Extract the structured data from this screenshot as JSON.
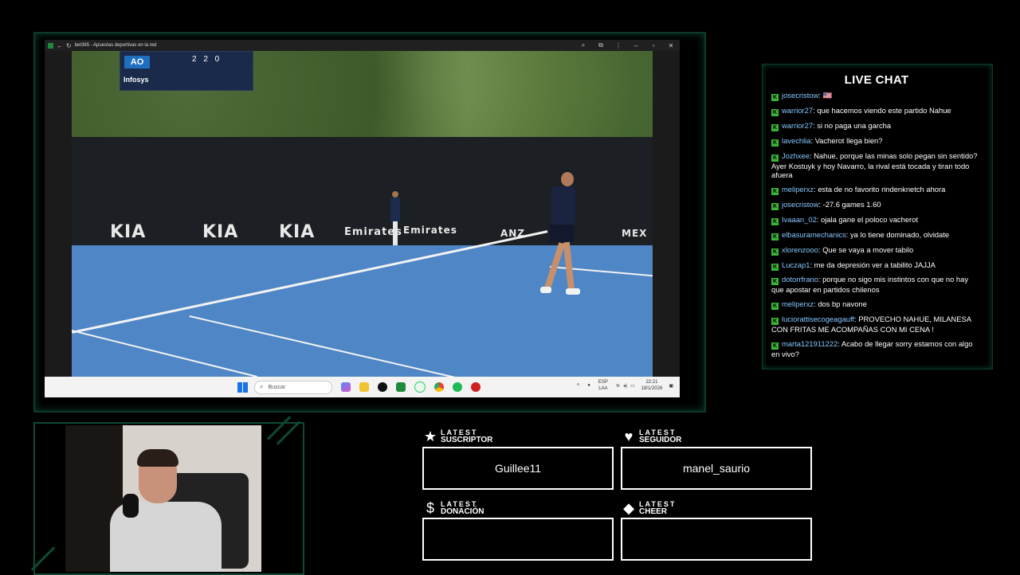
{
  "browser": {
    "title": "bet365 - Apuestas deportivas en la red",
    "scoreboard_brand": "AO",
    "scoreboard_score": "2 2 0",
    "scoreboard_sponsor": "Infosys"
  },
  "video": {
    "ads": [
      "KIA",
      "KIA",
      "KIA",
      "Emirates",
      "Emirates",
      "ANZ",
      "MEX"
    ]
  },
  "taskbar": {
    "search_placeholder": "Buscar",
    "lang_line1": "ESP",
    "lang_line2": "LAA",
    "time": "22:21",
    "date": "18/1/2026",
    "apps": [
      "copilot",
      "explorer",
      "tiktok",
      "bet365",
      "whatsapp",
      "chrome",
      "spotify",
      "game"
    ]
  },
  "chat": {
    "title": "LIVE CHAT",
    "messages": [
      {
        "user": "josecristow",
        "text": " 🇺🇸"
      },
      {
        "user": "warrior27",
        "text": " que hacemos viendo este partido Nahue"
      },
      {
        "user": "warrior27",
        "text": " si no paga una garcha"
      },
      {
        "user": "lavechlia",
        "text": " Vacherot llega bien?"
      },
      {
        "user": "Jozhxee",
        "text": " Nahue, porque las minas solo pegan sin sentido? Ayer Kostuyk y hoy Navarro, la rival está tocada y tiran todo afuera"
      },
      {
        "user": "meliperxz",
        "text": " esta de no favorito rindenknetch ahora"
      },
      {
        "user": "josecristow",
        "text": " -27.6 games 1.60"
      },
      {
        "user": "Ivaaan_02",
        "text": " ojala gane el poloco vacherot"
      },
      {
        "user": "elbasuramechanics",
        "text": " ya lo tiene dominado, olvidate"
      },
      {
        "user": "xlorenzooo",
        "text": " Que se vaya a mover tabilo"
      },
      {
        "user": "Luczap1",
        "text": " me da depresión ver a tabilito JAJJA"
      },
      {
        "user": "dotorrfrano",
        "text": " porque no sigo mis instintos con que no hay que apostar en partidos chilenos"
      },
      {
        "user": "meliperxz",
        "text": " dos bp navone"
      },
      {
        "user": "luciorattisecogeagauff",
        "text": " PROVECHO NAHUE, MILANESA CON FRITAS ME ACOMPAÑAS CON MI CENA !"
      },
      {
        "user": "marta121911222",
        "text": " Acabo de llegar sorry estamos con algo en vivo?"
      }
    ]
  },
  "widgets": {
    "suscriptor": {
      "line1": "LATEST",
      "line2": "SUSCRIPTOR",
      "value": "Guillee11",
      "icon": "star-icon"
    },
    "seguidor": {
      "line1": "LATEST",
      "line2": "SEGUIDOR",
      "value": "manel_saurio",
      "icon": "heart-icon"
    },
    "donacion": {
      "line1": "LATEST",
      "line2": "DONACIÓN",
      "value": "",
      "icon": "dollar-icon"
    },
    "cheer": {
      "line1": "LATEST",
      "line2": "CHEER",
      "value": "",
      "icon": "diamond-icon"
    }
  },
  "colors": {
    "accent": "#0d4a36",
    "chat_user": "#86c7ff",
    "badge": "#3ab43a"
  }
}
